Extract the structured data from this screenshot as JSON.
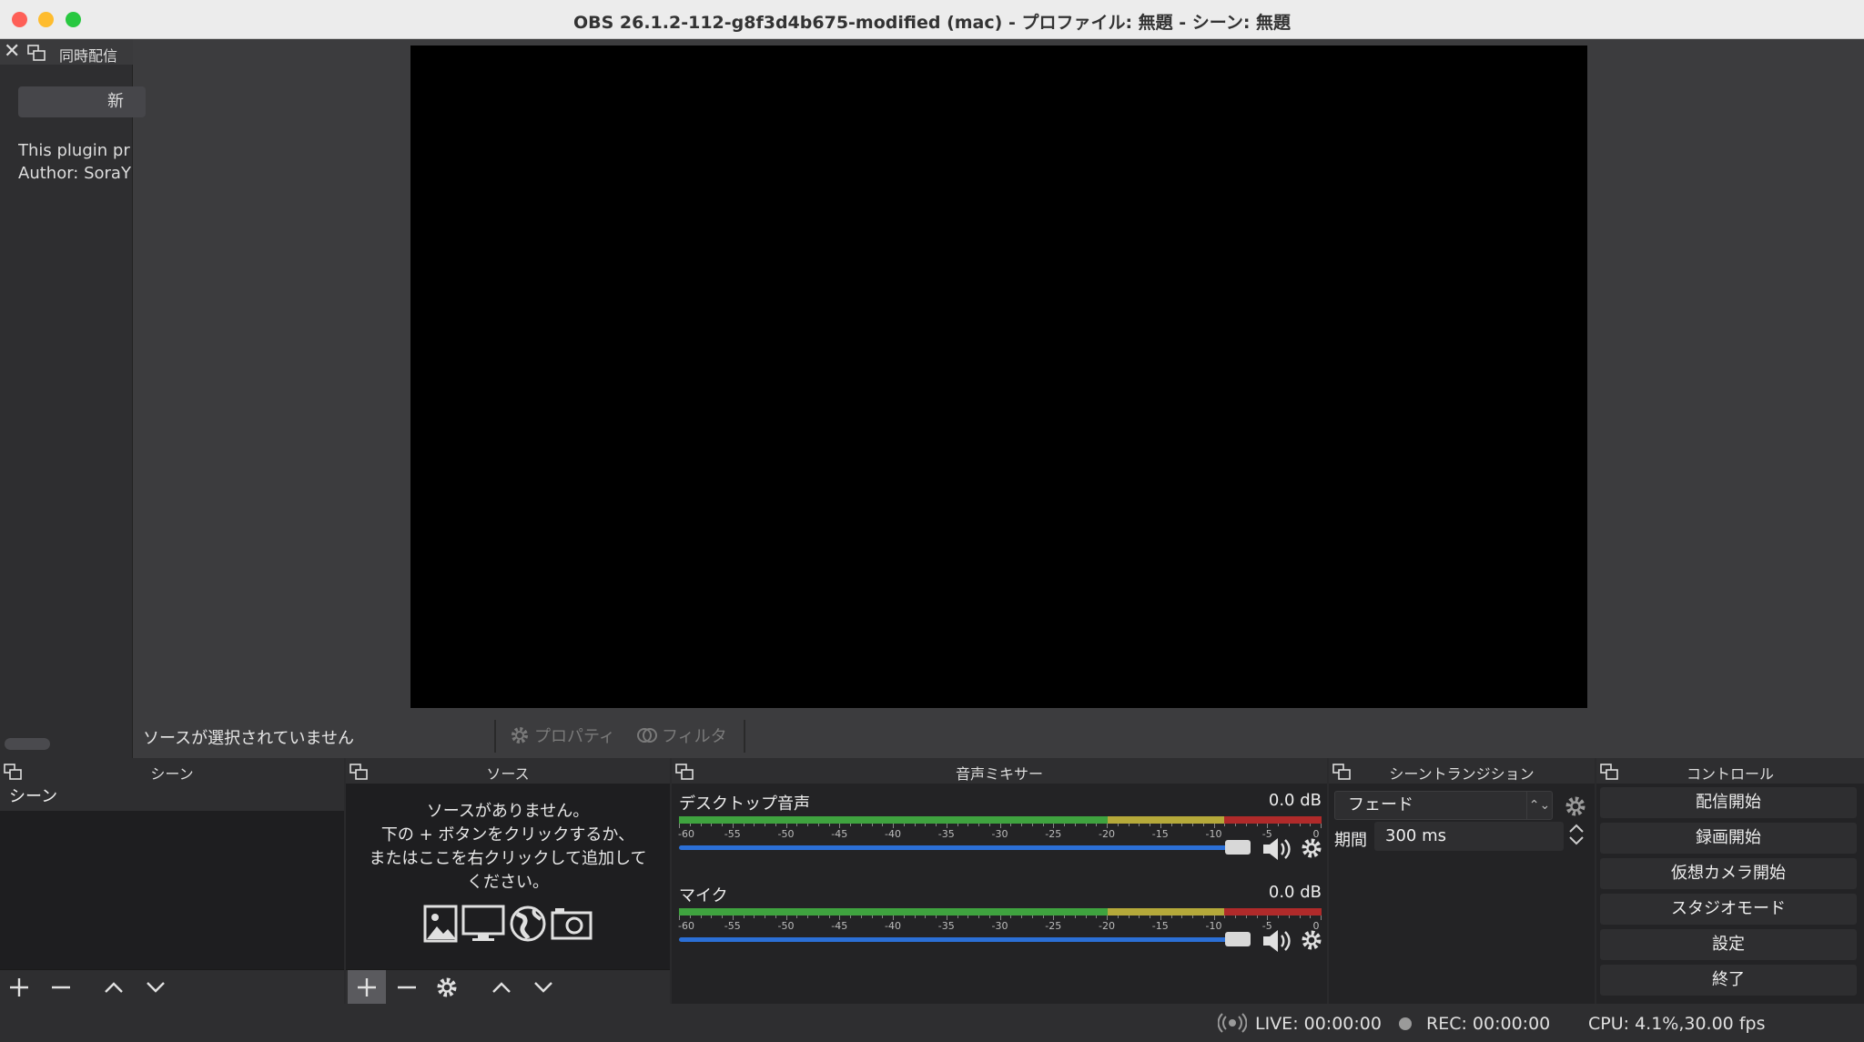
{
  "window": {
    "title": "OBS 26.1.2-112-g8f3d4b675-modified (mac) - プロファイル: 無題 - シーン: 無題"
  },
  "left_dock": {
    "title": "同時配信",
    "button_label": "新",
    "description_line1": "This plugin pr",
    "description_line2": "Author: SoraY"
  },
  "context_bar": {
    "status": "ソースが選択されていません",
    "properties_label": "プロパティ",
    "filters_label": "フィルタ"
  },
  "scenes": {
    "title": "シーン",
    "items": [
      "シーン"
    ]
  },
  "sources": {
    "title": "ソース",
    "empty_line1": "ソースがありません。",
    "empty_line2": "下の + ボタンをクリックするか、",
    "empty_line3": "またはここを右クリックして追加して",
    "empty_line4": "ください。"
  },
  "mixer": {
    "title": "音声ミキサー",
    "tick_labels": [
      "-60",
      "-55",
      "-50",
      "-45",
      "-40",
      "-35",
      "-30",
      "-25",
      "-20",
      "-15",
      "-10",
      "-5",
      "0"
    ],
    "tracks": [
      {
        "name": "デスクトップ音声",
        "db": "0.0 dB",
        "volume": 1.0
      },
      {
        "name": "マイク",
        "db": "0.0 dB",
        "volume": 1.0
      }
    ]
  },
  "transitions": {
    "title": "シーントランジション",
    "selected": "フェード",
    "duration_label": "期間",
    "duration_value": "300 ms"
  },
  "controls": {
    "title": "コントロール",
    "start_streaming": "配信開始",
    "start_recording": "録画開始",
    "start_virtual_camera": "仮想カメラ開始",
    "studio_mode": "スタジオモード",
    "settings": "設定",
    "exit": "終了"
  },
  "status_bar": {
    "live": "LIVE: 00:00:00",
    "rec": "REC: 00:00:00",
    "cpu": "CPU: 4.1%,30.00 fps"
  },
  "colors": {
    "meter_green": "#3fa33f",
    "meter_yellow": "#b5a93a",
    "meter_red": "#b02a2a",
    "slider_blue": "#2b6fd6"
  }
}
